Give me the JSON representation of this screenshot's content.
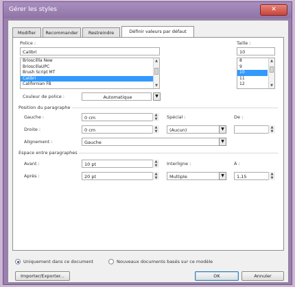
{
  "window": {
    "title": "Gérer les styles",
    "close_glyph": "✕"
  },
  "tabs": [
    {
      "label": "Modifier"
    },
    {
      "label": "Recommander"
    },
    {
      "label": "Restreindre"
    },
    {
      "label": "Définir valeurs par défaut"
    }
  ],
  "font": {
    "label": "Police :",
    "value": "Calibri",
    "list": [
      "Brioscillla New",
      "BrioscillaUPC",
      "Brush Script MT",
      "Calibri",
      "Californian FB"
    ],
    "selected_index": 3
  },
  "size": {
    "label": "Taille :",
    "value": "10",
    "list": [
      "8",
      "9",
      "10",
      "11",
      "12"
    ],
    "selected_index": 2
  },
  "font_color": {
    "label": "Couleur de police :",
    "value": "Automatique"
  },
  "paragraph": {
    "heading": "Position du paragraphe",
    "left_label": "Gauche :",
    "left_value": "0 cm",
    "right_label": "Droite :",
    "right_value": "0 cm",
    "special_label": "Spécial :",
    "special_value": "(Aucun)",
    "by_label": "De :",
    "by_value": "",
    "alignment_label": "Alignement :",
    "alignment_value": "Gauche"
  },
  "spacing": {
    "heading": "Espace entre paragraphes",
    "before_label": "Avant :",
    "before_value": "10 pt",
    "after_label": "Après :",
    "after_value": "20 pt",
    "line_label": "Interligne :",
    "line_value": "Multiple",
    "at_label": "À :",
    "at_value": "1,15"
  },
  "scope": {
    "option1": "Uniquement dans ce document",
    "option2": "Nouveaux documents basés sur ce modèle",
    "selected": "option1"
  },
  "buttons": {
    "import_export": "Importer/Exporter...",
    "ok": "OK",
    "cancel": "Annuler"
  }
}
